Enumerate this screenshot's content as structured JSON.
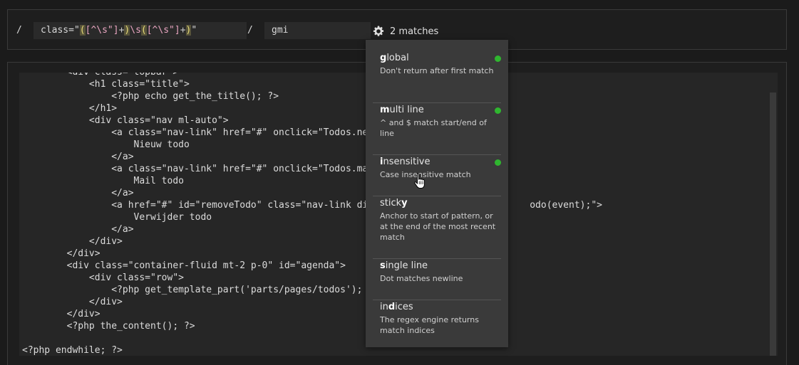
{
  "regex": {
    "open_delim": "/",
    "close_delim": "/",
    "tokens": [
      {
        "t": "class=\"",
        "k": "plain"
      },
      {
        "t": "(",
        "k": "grp"
      },
      {
        "t": "[^\\s\"]",
        "k": "set"
      },
      {
        "t": "+",
        "k": "q"
      },
      {
        "t": ")",
        "k": "grp"
      },
      {
        "t": "\\s",
        "k": "esc"
      },
      {
        "t": "(",
        "k": "grp"
      },
      {
        "t": "[^\\s\"]",
        "k": "set"
      },
      {
        "t": "+",
        "k": "q"
      },
      {
        "t": ")",
        "k": "grp"
      },
      {
        "t": "\"",
        "k": "plain"
      }
    ],
    "flags": "gmi",
    "settings_icon": "gear-icon",
    "match_count": "2 matches"
  },
  "code_lines": [
    "        <div class=\"topbar\">",
    "            <h1 class=\"title\">",
    "                <?php echo get_the_title(); ?>",
    "            </h1>",
    "            <div class=\"nav ml-auto\">",
    "                <a class=\"nav-link\" href=\"#\" onclick=\"Todos.newTodo",
    "                    Nieuw todo",
    "                </a>",
    "                <a class=\"nav-link\" href=\"#\" onclick=\"Todos.mailTodo",
    "                    Mail todo",
    "                </a>",
    "                <a href=\"#\" id=\"removeTodo\" class=\"nav-link disable                        odo(event);\">",
    "                    Verwijder todo",
    "                </a>",
    "            </div>",
    "        </div>",
    "        <div class=\"container-fluid mt-2 p-0\" id=\"agenda\">",
    "            <div class=\"row\">",
    "                <?php get_template_part('parts/pages/todos'); ?>",
    "            </div>",
    "        </div>",
    "        <?php the_content(); ?>",
    "",
    "<?php endwhile; ?>"
  ],
  "flag_menu": [
    {
      "pre": "",
      "key": "g",
      "post": "lobal",
      "desc": "Don't return after first match",
      "enabled": true
    },
    {
      "pre": "",
      "key": "m",
      "post": "ulti line",
      "desc": "^ and $ match start/end of line",
      "enabled": true
    },
    {
      "pre": "",
      "key": "i",
      "post": "nsensitive",
      "desc": "Case insensitive match",
      "enabled": true
    },
    {
      "pre": "stick",
      "key": "y",
      "post": "",
      "desc": "Anchor to start of pattern, or at the end of the most recent match",
      "enabled": false
    },
    {
      "pre": "",
      "key": "s",
      "post": "ingle line",
      "desc": "Dot matches newline",
      "enabled": false
    },
    {
      "pre": "in",
      "key": "d",
      "post": "ices",
      "desc": "The regex engine returns match indices",
      "enabled": false
    }
  ],
  "colors": {
    "enabled_dot": "#2fb62f",
    "menu_bg": "#3a3a3a",
    "group_highlight": "#57533a"
  }
}
